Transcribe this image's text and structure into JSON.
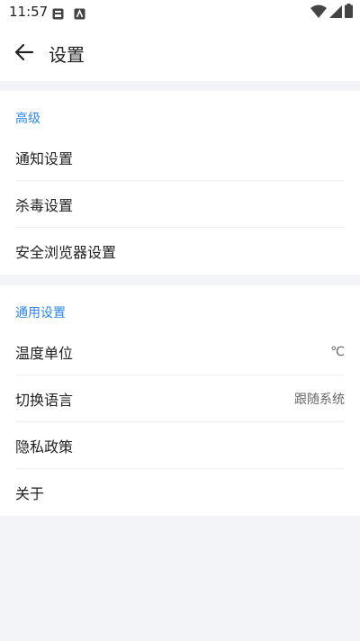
{
  "status": {
    "time": "11:57"
  },
  "header": {
    "title": "设置"
  },
  "sections": [
    {
      "title": "高级",
      "items": [
        {
          "label": "通知设置"
        },
        {
          "label": "杀毒设置"
        },
        {
          "label": "安全浏览器设置"
        }
      ]
    },
    {
      "title": "通用设置",
      "items": [
        {
          "label": "温度单位",
          "value": "℃"
        },
        {
          "label": "切换语言",
          "value": "跟随系统"
        },
        {
          "label": "隐私政策"
        },
        {
          "label": "关于"
        }
      ]
    }
  ],
  "colors": {
    "accent": "#2d86e8",
    "background": "#f3f4f8"
  }
}
